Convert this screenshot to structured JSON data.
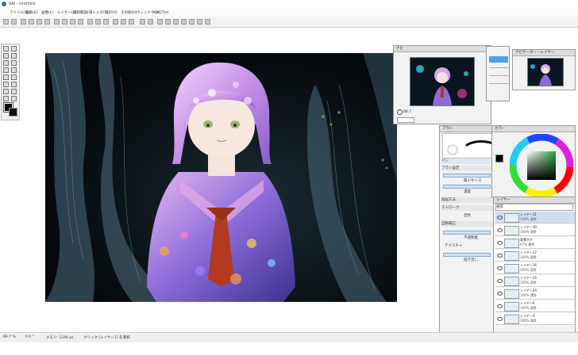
{
  "window": {
    "title": "SAI - Untitled"
  },
  "menu": [
    "ファイル(F)",
    "編集(E)",
    "画像(C)",
    "レイヤー(L)",
    "選択範囲(S)",
    "フィルタ(T)",
    "表示(V)",
    "その他(O)",
    "ウィンドウ(W)",
    "ヘルプ(H)"
  ],
  "status": {
    "zoom": "66.7 %",
    "angle": "0.0 °",
    "memory": "メモリ: 1246 ps",
    "message": "クリック [レイヤー1] を選択"
  },
  "navigator": {
    "title": "ナビ",
    "zoom": "66.7"
  },
  "panel_left": {
    "title": "ナビ"
  },
  "panel_right": {
    "title": "ナビゲーター・レイヤー"
  },
  "brush": {
    "title": "ペン",
    "tab": "ブラシ",
    "size_label": "最小サイズ",
    "density_label": "濃度",
    "opacity_label": "不透明度",
    "texture_label": "テクスチャ",
    "mix_label": "混色",
    "persist": "描き出し",
    "sections": [
      "ブラシ設定",
      "描画方法",
      "ストローク",
      "自動補正"
    ],
    "size_value": "16",
    "density_value": "100"
  },
  "color": {
    "title": "カラー"
  },
  "layers": {
    "title": "レイヤー",
    "mode": "通常",
    "items": [
      {
        "name": "レイヤー31",
        "mode": "100% 通常"
      },
      {
        "name": "レイヤー30",
        "mode": "100% 通常"
      },
      {
        "name": "背景ボケ",
        "mode": "67% 通常"
      },
      {
        "name": "レイヤー27",
        "mode": "100% 通常"
      },
      {
        "name": "レイヤー26",
        "mode": "100% 通常"
      },
      {
        "name": "レイヤー25",
        "mode": "100% 通常"
      },
      {
        "name": "レイヤー24",
        "mode": "100% 通常"
      },
      {
        "name": "レイヤー6",
        "mode": "100% 通常"
      },
      {
        "name": "レイヤー4",
        "mode": "100% 通常"
      }
    ]
  }
}
